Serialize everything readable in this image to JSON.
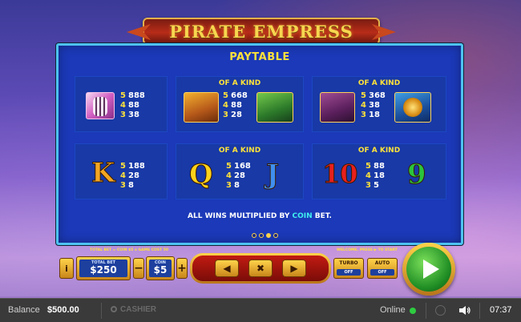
{
  "game": {
    "title": "PIRATE EMPRESS"
  },
  "paytable": {
    "title": "PAYTABLE",
    "cells": [
      {
        "header": "",
        "symbols": [
          "tiger-icon"
        ],
        "pays": [
          {
            "count": "5",
            "value": "888"
          },
          {
            "count": "4",
            "value": "88"
          },
          {
            "count": "3",
            "value": "38"
          }
        ]
      },
      {
        "header": "OF A KIND",
        "symbols": [
          "treasure-chest-icon",
          "warrior-icon"
        ],
        "pays": [
          {
            "count": "5",
            "value": "668"
          },
          {
            "count": "4",
            "value": "88"
          },
          {
            "count": "3",
            "value": "28"
          }
        ]
      },
      {
        "header": "OF A KIND",
        "symbols": [
          "horn-icon",
          "compass-icon"
        ],
        "pays": [
          {
            "count": "5",
            "value": "368"
          },
          {
            "count": "4",
            "value": "38"
          },
          {
            "count": "3",
            "value": "18"
          }
        ]
      },
      {
        "header": "",
        "letters": [
          "K"
        ],
        "pays": [
          {
            "count": "5",
            "value": "188"
          },
          {
            "count": "4",
            "value": "28"
          },
          {
            "count": "3",
            "value": "8"
          }
        ]
      },
      {
        "header": "OF A KIND",
        "letters": [
          "Q",
          "J"
        ],
        "pays": [
          {
            "count": "5",
            "value": "168"
          },
          {
            "count": "4",
            "value": "28"
          },
          {
            "count": "3",
            "value": "8"
          }
        ]
      },
      {
        "header": "OF A KIND",
        "letters": [
          "10",
          "9"
        ],
        "pays": [
          {
            "count": "5",
            "value": "88"
          },
          {
            "count": "4",
            "value": "18"
          },
          {
            "count": "3",
            "value": "5"
          }
        ]
      }
    ],
    "note": {
      "prefix": "ALL WINS MULTIPLIED BY ",
      "highlight": "COIN",
      "suffix": " BET."
    },
    "pages": {
      "count": 4,
      "current": 3
    }
  },
  "controls": {
    "bet_info": "TOTAL BET = COIN $5 x GAME COST 50",
    "info_label": "i",
    "total_bet_label": "TOTAL BET",
    "total_bet_value": "$250",
    "coin_label": "COIN",
    "coin_value": "$5",
    "minus_label": "−",
    "plus_label": "+",
    "prev_label": "◀",
    "close_label": "✖",
    "next_label": "▶",
    "welcome": "WELCOME. PRESS ▶ TO START",
    "turbo_label": "TURBO",
    "turbo_state": "OFF",
    "auto_label": "AUTO",
    "auto_state": "OFF"
  },
  "status": {
    "balance_label": "Balance",
    "balance_value": "$500.00",
    "cashier_label": "CASHIER",
    "online_label": "Online",
    "time": "07:37"
  },
  "colors": {
    "accent": "#ffe23a",
    "panel": "#1b39b8",
    "border": "#4ec2f2",
    "spin": "#1f8d24"
  }
}
